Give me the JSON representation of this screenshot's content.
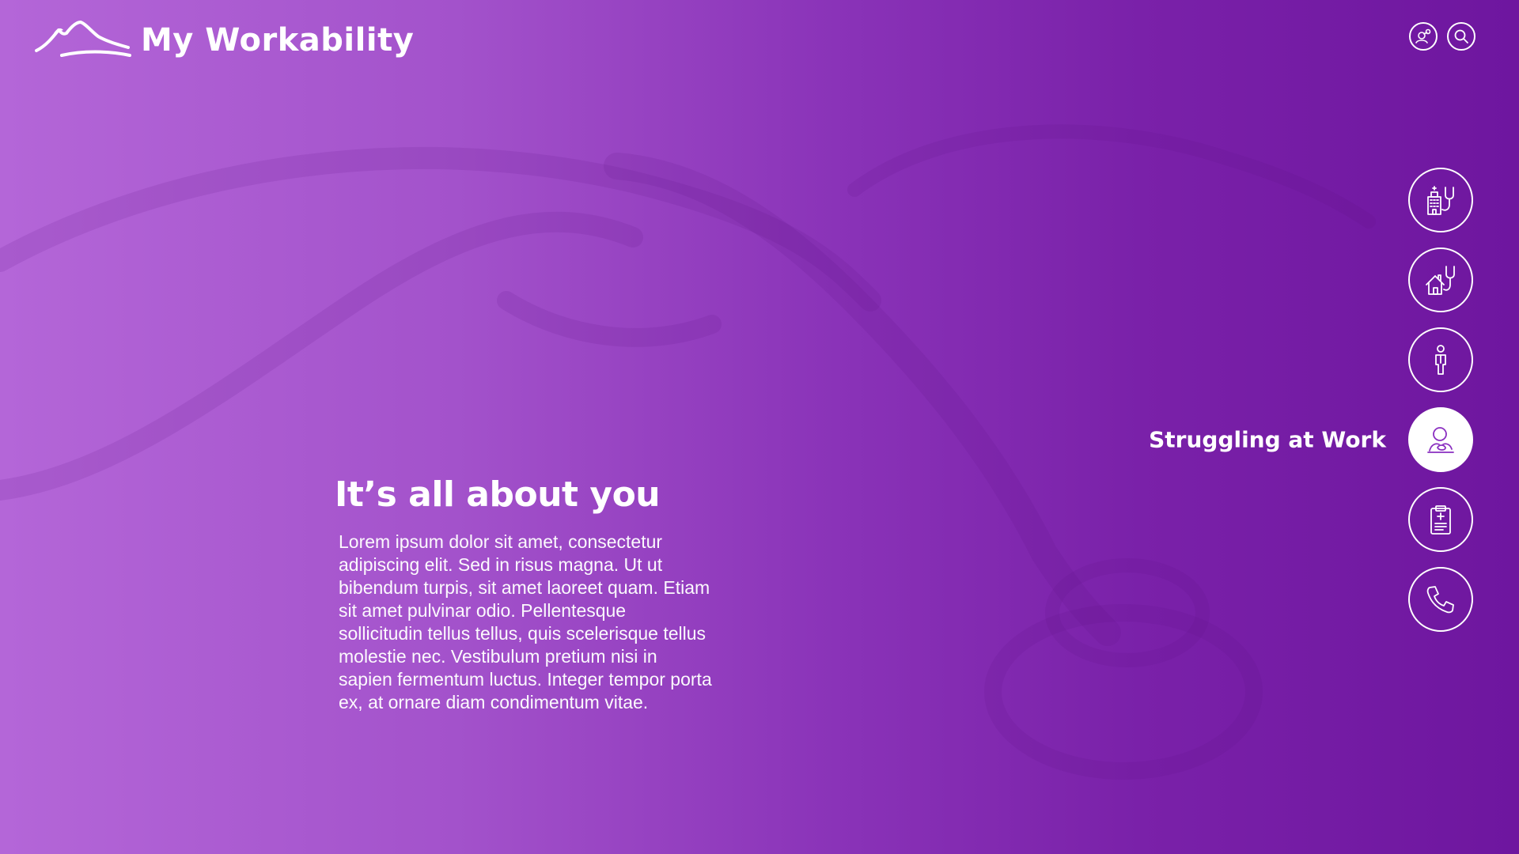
{
  "app": {
    "name": "My Workability"
  },
  "colors": {
    "gradient_left": "#b466d8",
    "gradient_right": "#6e169f",
    "text": "#ffffff",
    "active_icon": "#8a2fc0"
  },
  "header": {
    "logo_icon": "mountain-logo",
    "actions": [
      {
        "icon": "user-link-icon"
      },
      {
        "icon": "search-icon"
      }
    ]
  },
  "hero": {
    "title": "It’s all about you",
    "body": "Lorem ipsum dolor sit amet, consectetur adipiscing elit. Sed in risus magna. Ut ut bibendum turpis, sit amet laoreet quam. Etiam sit amet pulvinar odio. Pellentesque sollicitudin tellus tellus, quis scelerisque tellus molestie nec. Vestibulum pretium nisi in sapien fermentum luctus. Integer tempor porta ex, at ornare diam condimentum vitae."
  },
  "side_nav": {
    "items": [
      {
        "icon": "hospital-stethoscope-icon",
        "active": false
      },
      {
        "icon": "home-stethoscope-icon",
        "active": false
      },
      {
        "icon": "person-icon",
        "active": false
      },
      {
        "icon": "worker-at-desk-icon",
        "active": true,
        "label": "Struggling at Work"
      },
      {
        "icon": "medical-clipboard-icon",
        "active": false
      },
      {
        "icon": "phone-icon",
        "active": false
      }
    ]
  }
}
